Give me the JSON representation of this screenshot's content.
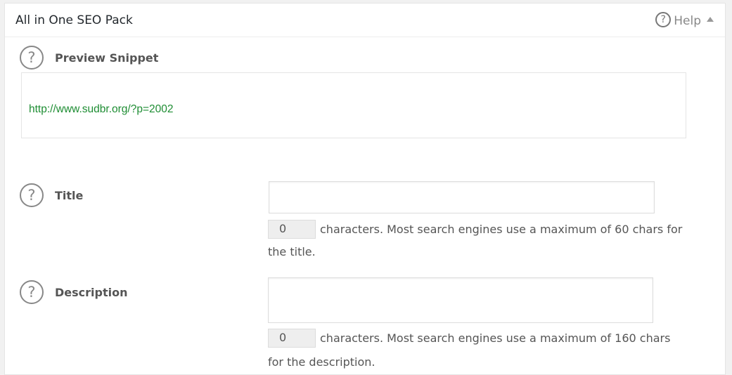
{
  "panel": {
    "title": "All in One SEO Pack",
    "help_label": "Help"
  },
  "preview": {
    "label": "Preview Snippet",
    "url": "http://www.sudbr.org/?p=2002"
  },
  "title_field": {
    "label": "Title",
    "value": "",
    "count": "0",
    "hint_line1": "characters. Most search engines use a maximum of 60 chars for",
    "hint_line2": "the title."
  },
  "description_field": {
    "label": "Description",
    "value": "",
    "count": "0",
    "hint_line1": "characters. Most search engines use a maximum of 160 chars",
    "hint_line2": "for the description."
  },
  "icons": {
    "help": "question-circle-icon",
    "collapse": "caret-up-icon"
  },
  "colors": {
    "url_green": "#1e8d33",
    "icon_gray": "#888888"
  }
}
